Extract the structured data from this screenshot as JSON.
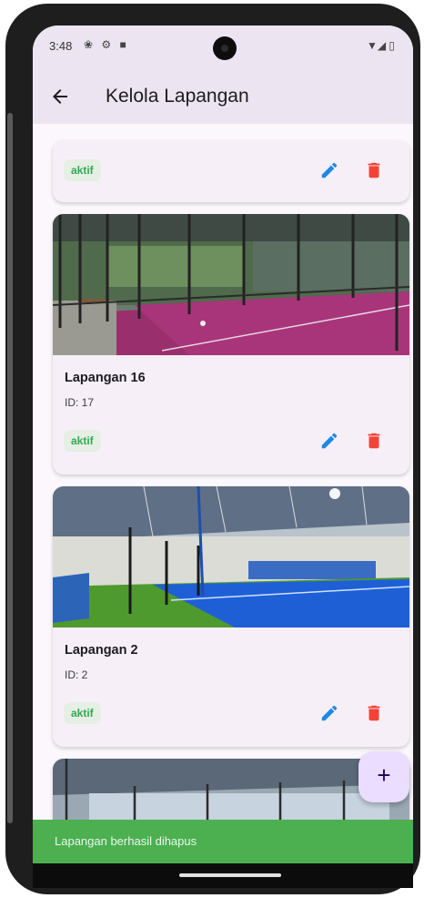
{
  "status_bar": {
    "time": "3:48",
    "left_icons": "❀ ⚙ ■",
    "right_icons": "▼◢ ▯"
  },
  "app_bar": {
    "title": "Kelola Lapangan",
    "back_icon": "arrow-back-icon"
  },
  "courts": [
    {
      "name": "",
      "id": "",
      "status": "aktif",
      "photo": ""
    },
    {
      "name": "Lapangan 16",
      "id": "ID: 17",
      "status": "aktif",
      "photo": "pink-court-photo"
    },
    {
      "name": "Lapangan 2",
      "id": "ID: 2",
      "status": "aktif",
      "photo": "blue-court-photo"
    },
    {
      "name": "",
      "id": "",
      "status": "",
      "photo": "indoor-hall-photo"
    }
  ],
  "colors": {
    "app_bar_bg": "#ece5f1",
    "card_bg": "#f6eff8",
    "status_chip_text": "#34a853",
    "status_chip_bg": "#e5efe3",
    "edit_icon": "#1e88e5",
    "delete_icon": "#f44336",
    "fab_bg": "#eaddff",
    "snackbar_bg": "#4caf50"
  },
  "fab": {
    "label": "+"
  },
  "snackbar": {
    "message": "Lapangan berhasil dihapus"
  }
}
